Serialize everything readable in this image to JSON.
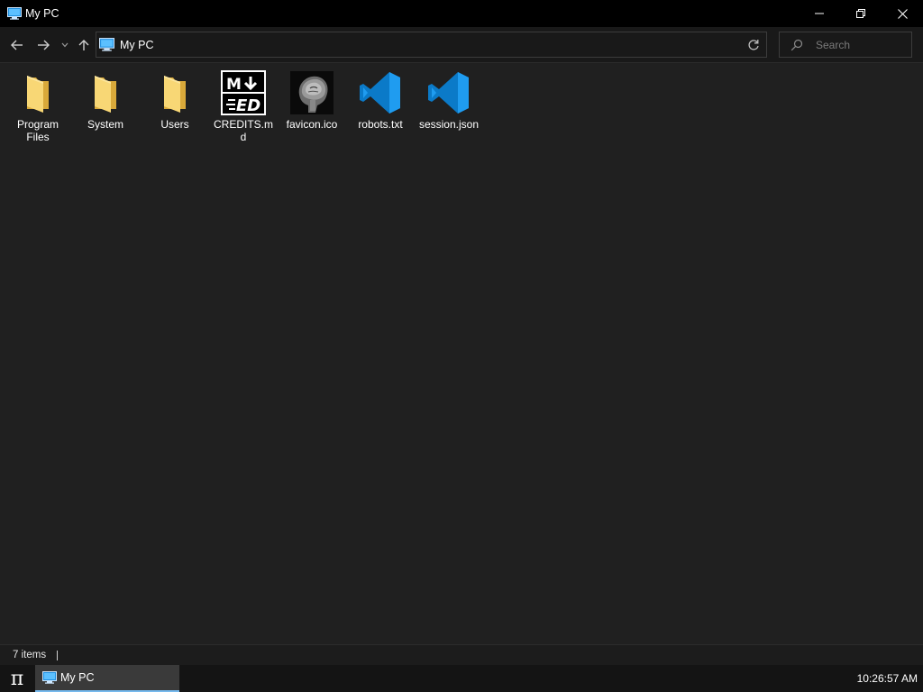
{
  "window": {
    "title": "My PC",
    "icon": "pc-icon"
  },
  "nav": {
    "back_icon": "arrow-left-icon",
    "forward_icon": "arrow-right-icon",
    "recent_icon": "chevron-down-icon",
    "up_icon": "arrow-up-icon",
    "address_path": "My PC",
    "refresh_icon": "refresh-icon",
    "search_placeholder": "Search"
  },
  "items": [
    {
      "label": "Program Files",
      "type": "folder"
    },
    {
      "label": "System",
      "type": "folder"
    },
    {
      "label": "Users",
      "type": "folder"
    },
    {
      "label": "CREDITS.md",
      "type": "markdown"
    },
    {
      "label": "favicon.ico",
      "type": "image"
    },
    {
      "label": "robots.txt",
      "type": "vscode"
    },
    {
      "label": "session.json",
      "type": "vscode"
    }
  ],
  "status": {
    "item_count": "7 items"
  },
  "taskbar": {
    "start_glyph": "π",
    "task_label": "My PC",
    "clock": "10:26:57 AM"
  },
  "colors": {
    "accent": "#76b9ed",
    "folder": "#f8d775",
    "vscode": "#0098ff"
  }
}
